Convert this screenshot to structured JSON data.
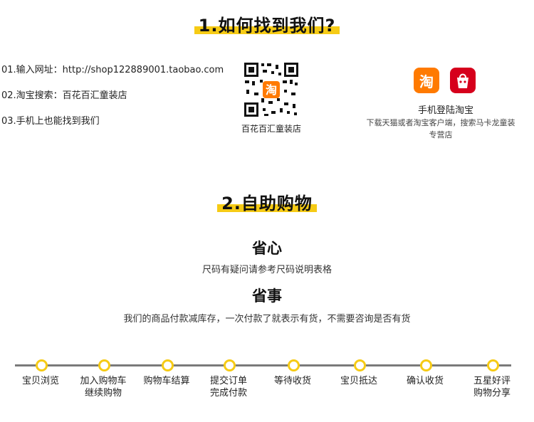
{
  "section1": {
    "title": "1.如何找到我们?"
  },
  "find_methods": [
    "01.输入网址：http://shop122889001.taobao.com",
    "02.淘宝搜索：百花百汇童装店",
    "03.手机上也能找到我们"
  ],
  "qr": {
    "caption": "百花百汇童装店",
    "icon": "qr-code-icon"
  },
  "mobile": {
    "taobao_glyph": "淘",
    "title": "手机登陆淘宝",
    "description": "下载天猫或者淘宝客户端，搜索马卡龙童装专营店",
    "icons": [
      "taobao-app-icon",
      "tmall-app-icon"
    ],
    "colors": {
      "taobao": "#ff7a00",
      "tmall": "#d6001c"
    }
  },
  "section2": {
    "title": "2.自助购物"
  },
  "points": [
    {
      "head": "省心",
      "desc": "尺码有疑问请参考尺码说明表格"
    },
    {
      "head": "省事",
      "desc": "我们的商品付款减库存，一次付款了就表示有货，不需要咨询是否有货"
    }
  ],
  "steps": [
    [
      "宝贝浏览"
    ],
    [
      "加入购物车",
      "继续购物"
    ],
    [
      "购物车结算"
    ],
    [
      "提交订单",
      "完成付款"
    ],
    [
      "等待收货"
    ],
    [
      "宝贝抵达"
    ],
    [
      "确认收货"
    ],
    [
      "五星好评",
      "购物分享"
    ]
  ],
  "colors": {
    "accent": "#f6cb15",
    "timeline": "#7a7a7a"
  }
}
